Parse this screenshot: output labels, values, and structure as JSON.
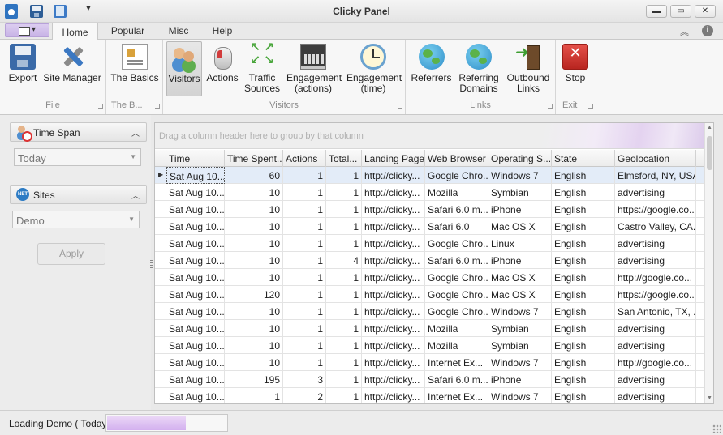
{
  "window": {
    "title": "Clicky Panel"
  },
  "tabs": [
    "Home",
    "Popular",
    "Misc",
    "Help"
  ],
  "ribbon": {
    "groups": [
      {
        "label": "File",
        "buttons": [
          "Export",
          "Site Manager"
        ]
      },
      {
        "label": "The B...",
        "buttons": [
          "The Basics"
        ]
      },
      {
        "label": "Visitors",
        "buttons": [
          "Visitors",
          "Actions",
          "Traffic Sources",
          "Engagement (actions)",
          "Engagement (time)"
        ]
      },
      {
        "label": "Links",
        "buttons": [
          "Referrers",
          "Referring Domains",
          "Outbound Links"
        ]
      },
      {
        "label": "Exit",
        "buttons": [
          "Stop"
        ]
      }
    ],
    "selected_button": "Visitors"
  },
  "left_panel": {
    "time_span": {
      "title": "Time Span",
      "value": "Today"
    },
    "sites": {
      "title": "Sites",
      "value": "Demo"
    },
    "net_badge": "NET",
    "apply_label": "Apply"
  },
  "grid": {
    "group_hint": "Drag a column header here to group by that column",
    "columns": [
      "Time",
      "Time Spent...",
      "Actions",
      "Total...",
      "Landing Page",
      "Web Browser",
      "Operating S...",
      "State",
      "Geolocation"
    ],
    "rows": [
      [
        "Sat Aug 10...",
        "60",
        "1",
        "1",
        "http://clicky...",
        "Google Chro...",
        "Windows 7",
        "English",
        "Elmsford, NY, USA"
      ],
      [
        "Sat Aug 10...",
        "10",
        "1",
        "1",
        "http://clicky...",
        "Mozilla",
        "Symbian",
        "English",
        "advertising"
      ],
      [
        "Sat Aug 10...",
        "10",
        "1",
        "1",
        "http://clicky...",
        "Safari 6.0 m...",
        "iPhone",
        "English",
        "https://google.co..."
      ],
      [
        "Sat Aug 10...",
        "10",
        "1",
        "1",
        "http://clicky...",
        "Safari 6.0",
        "Mac OS X",
        "English",
        "Castro Valley, CA..."
      ],
      [
        "Sat Aug 10...",
        "10",
        "1",
        "1",
        "http://clicky...",
        "Google Chro...",
        "Linux",
        "English",
        "advertising"
      ],
      [
        "Sat Aug 10...",
        "10",
        "1",
        "4",
        "http://clicky...",
        "Safari 6.0 m...",
        "iPhone",
        "English",
        "advertising"
      ],
      [
        "Sat Aug 10...",
        "10",
        "1",
        "1",
        "http://clicky...",
        "Google Chro...",
        "Mac OS X",
        "English",
        "http://google.co..."
      ],
      [
        "Sat Aug 10...",
        "120",
        "1",
        "1",
        "http://clicky...",
        "Google Chro...",
        "Mac OS X",
        "English",
        "https://google.co..."
      ],
      [
        "Sat Aug 10...",
        "10",
        "1",
        "1",
        "http://clicky...",
        "Google Chro...",
        "Windows 7",
        "English",
        "San Antonio, TX, ..."
      ],
      [
        "Sat Aug 10...",
        "10",
        "1",
        "1",
        "http://clicky...",
        "Mozilla",
        "Symbian",
        "English",
        "advertising"
      ],
      [
        "Sat Aug 10...",
        "10",
        "1",
        "1",
        "http://clicky...",
        "Mozilla",
        "Symbian",
        "English",
        "advertising"
      ],
      [
        "Sat Aug 10...",
        "10",
        "1",
        "1",
        "http://clicky...",
        "Internet Ex...",
        "Windows 7",
        "English",
        "http://google.co..."
      ],
      [
        "Sat Aug 10...",
        "195",
        "3",
        "1",
        "http://clicky...",
        "Safari 6.0 m...",
        "iPhone",
        "English",
        "advertising"
      ],
      [
        "Sat Aug 10...",
        "1",
        "2",
        "1",
        "http://clicky...",
        "Internet Ex...",
        "Windows 7",
        "English",
        "advertising"
      ]
    ]
  },
  "status": {
    "text": "Loading Demo ( Today )",
    "progress": 0.65
  },
  "colors": {
    "accent": "#d3b0ef",
    "selection": "#e3ecf8"
  }
}
